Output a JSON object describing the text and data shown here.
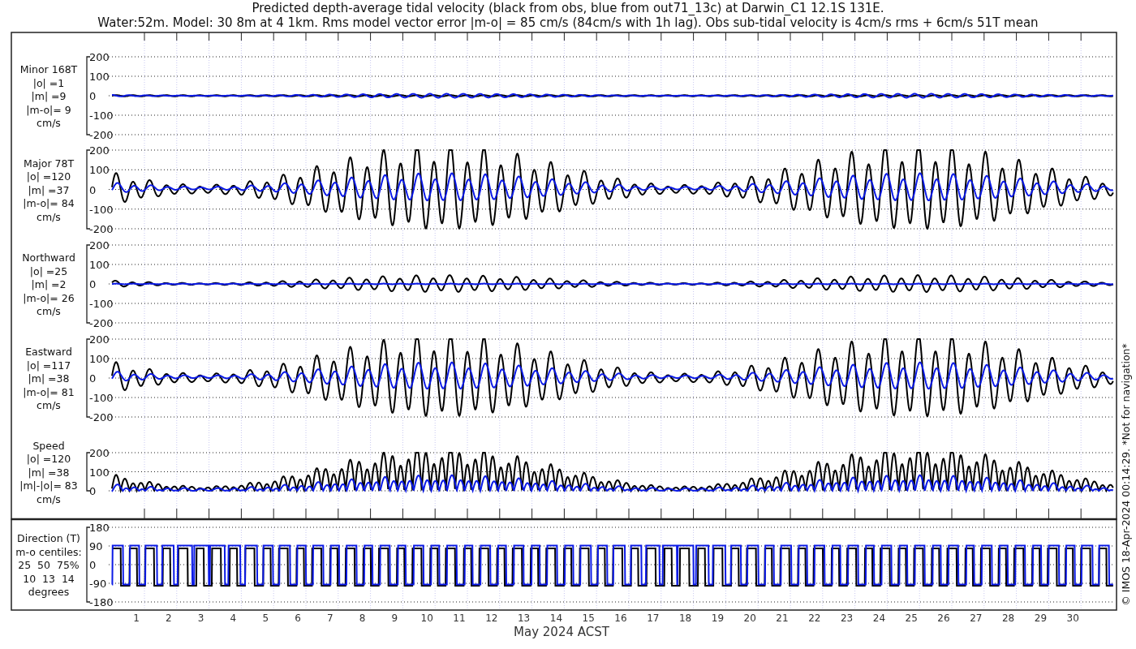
{
  "title_lines": [
    "Predicted depth-average tidal velocity (black from obs, blue from out71_13c) at Darwin_C1 12.1S 131E.",
    "Water:52m. Model: 30 8m at 4 1km. Rms model vector error |m-o| = 85 cm/s (84cm/s with 1h lag). Obs sub-tidal velocity is 4cm/s rms + 6cm/s 51T mean"
  ],
  "panels": [
    {
      "kind": "minor",
      "label_lines": [
        "Minor 168T",
        "|o| =1",
        "|m| =9",
        "|m-o|= 9",
        "cm/s"
      ],
      "yticks": [
        "200",
        "100",
        "0",
        "-100",
        "-200"
      ]
    },
    {
      "kind": "major",
      "label_lines": [
        "Major 78T",
        "|o| =120",
        "|m| =37",
        "|m-o|= 84",
        "cm/s"
      ],
      "yticks": [
        "200",
        "100",
        "0",
        "-100",
        "-200"
      ]
    },
    {
      "kind": "north",
      "label_lines": [
        "Northward",
        "|o| =25",
        "|m| =2",
        "|m-o|= 26",
        "cm/s"
      ],
      "yticks": [
        "200",
        "100",
        "0",
        "-100",
        "-200"
      ]
    },
    {
      "kind": "east",
      "label_lines": [
        "Eastward",
        "|o| =117",
        "|m| =38",
        "|m-o|= 81",
        "cm/s"
      ],
      "yticks": [
        "200",
        "100",
        "0",
        "-100",
        "-200"
      ]
    },
    {
      "kind": "speed",
      "label_lines": [
        "Speed",
        "|o| =120",
        "|m| =38",
        "|m|-|o|= 83",
        "cm/s"
      ],
      "yticks": [
        "200",
        "100",
        "0"
      ]
    },
    {
      "kind": "direction",
      "label_lines": [
        "Direction (T)",
        "m-o centiles:",
        "25  50  75%",
        "10  13  14",
        "degrees"
      ],
      "yticks": [
        "180",
        "90",
        "0",
        "-90",
        "-180"
      ]
    }
  ],
  "xticks": [
    "1",
    "2",
    "3",
    "4",
    "5",
    "6",
    "7",
    "8",
    "9",
    "10",
    "11",
    "12",
    "13",
    "14",
    "15",
    "16",
    "17",
    "18",
    "19",
    "20",
    "21",
    "22",
    "23",
    "24",
    "25",
    "26",
    "27",
    "28",
    "29",
    "30"
  ],
  "xlabel": "May 2024 ACST",
  "credit": "© IMOS 18-Apr-2024 00:14:29. *Not for navigation*"
}
